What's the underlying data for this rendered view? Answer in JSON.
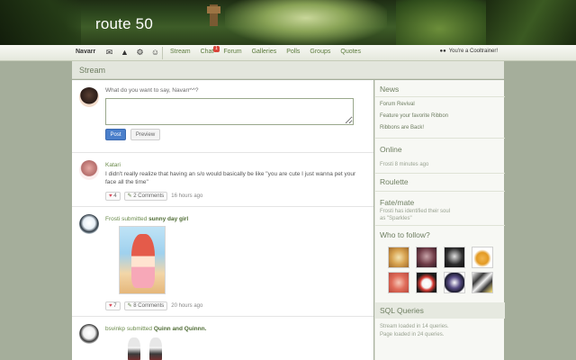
{
  "site": {
    "title": "route 50"
  },
  "nav": {
    "username": "Navarr",
    "icons": [
      "mail-icon",
      "bell-icon",
      "gear-icon",
      "user-icon"
    ],
    "links": [
      "Stream",
      "Chat",
      "Forum",
      "Galleries",
      "Polls",
      "Groups",
      "Quotes"
    ],
    "chat_badge": "1",
    "right_text": "You're a Cooltrainer!"
  },
  "stream": {
    "title": "Stream"
  },
  "compose": {
    "prompt": "What do you want to say, Navarr^^?",
    "post_label": "Post",
    "preview_label": "Preview"
  },
  "posts": [
    {
      "author": "Katari",
      "text": "I didn't really realize that having an s/o would basically be like \"you are cute I just wanna pet your face all the time\"",
      "likes": "4",
      "comments": "2 Comments",
      "time": "16 hours ago"
    },
    {
      "author": "Frosti",
      "action": "submitted",
      "item": "sunny day girl",
      "likes": "7",
      "comments": "8 Comments",
      "time": "20 hours ago"
    },
    {
      "author": "bsvinkp",
      "action": "submitted",
      "item": "Quinn and Quinnn."
    }
  ],
  "sidebar": {
    "news_title": "News",
    "news": [
      "Forum Revival",
      "Feature your favorite Ribbon",
      "Ribbons are Back!"
    ],
    "online_title": "Online",
    "online_text": "Frosti 8 minutes ago",
    "roulette_title": "Roulette",
    "fatemate_title": "Fate/mate",
    "fatemate_text": "Frosti has identified their soul as \"Sparkles\"",
    "follow_title": "Who to follow?",
    "sql_title": "SQL Queries",
    "sql_lines": [
      "Stream loaded in 14 queries.",
      "Page loaded in 24 queries."
    ]
  }
}
